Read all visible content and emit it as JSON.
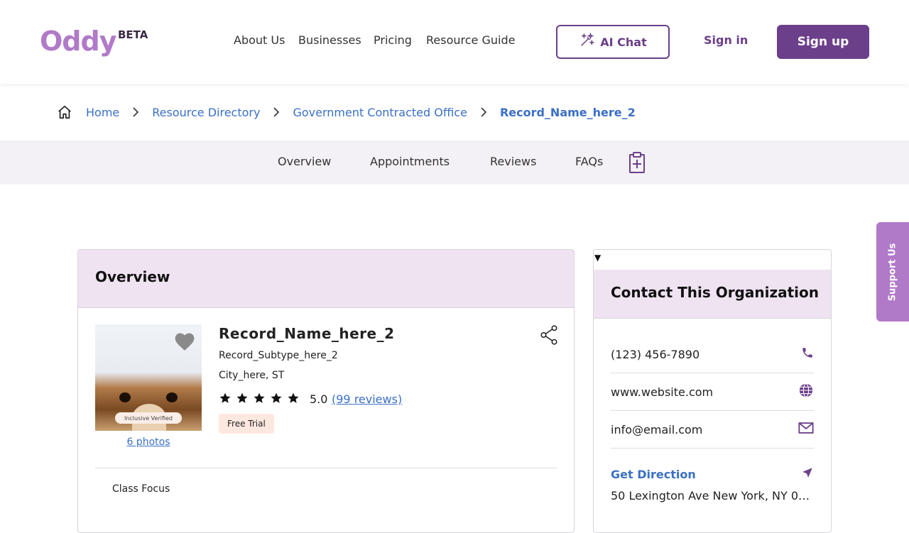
{
  "header": {
    "logo": "Oddy",
    "beta": "BETA",
    "nav": [
      "About Us",
      "Businesses",
      "Pricing",
      "Resource Guide"
    ],
    "ai_chat": "AI Chat",
    "sign_in": "Sign in",
    "sign_up": "Sign up"
  },
  "breadcrumb": {
    "items": [
      "Home",
      "Resource Directory",
      "Government Contracted Office"
    ],
    "current": "Record_Name_here_2"
  },
  "tabs": [
    "Overview",
    "Appointments",
    "Reviews",
    "FAQs"
  ],
  "overview": {
    "title": "Overview",
    "badge": "Inclusive Verified",
    "photos": "6 photos",
    "name": "Record_Name_here_2",
    "subtype": "Record_Subtype_here_2",
    "city": "City_here, ST",
    "rating": "5.0",
    "stars": 5,
    "reviews": "(99 reviews)",
    "tag": "Free Trial",
    "section": "Class Focus"
  },
  "contact": {
    "title": "Contact This Organization",
    "phone": "(123) 456-7890",
    "website": "www.website.com",
    "email": "info@email.com",
    "direction": "Get Direction",
    "address": "50 Lexington Ave New York, NY 01..."
  },
  "support": "Support Us",
  "colors": {
    "brand": "#6b3f8a",
    "logo": "#b07ac8",
    "link": "#3b6fc7",
    "header_tint": "#efe3f2"
  }
}
